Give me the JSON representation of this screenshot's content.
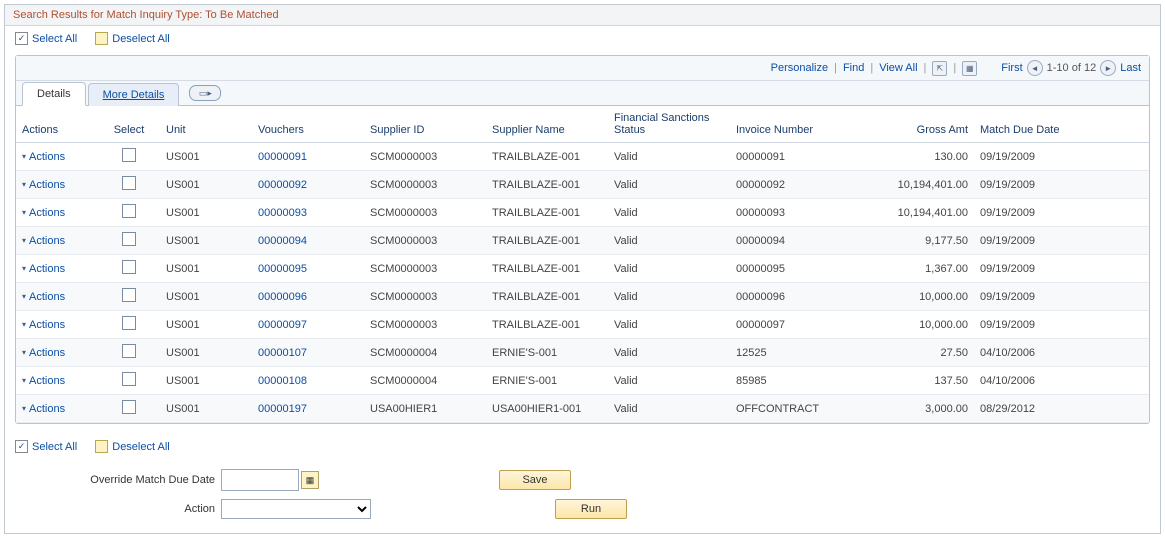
{
  "header": {
    "title": "Search Results for Match Inquiry Type: To Be Matched"
  },
  "selectBar": {
    "selectAll": "Select All",
    "deselectAll": "Deselect All"
  },
  "toolbar": {
    "personalize": "Personalize",
    "find": "Find",
    "viewAll": "View All"
  },
  "pager": {
    "first": "First",
    "range": "1-10 of 12",
    "last": "Last"
  },
  "tabs": {
    "details": "Details",
    "moreDetails": "More Details"
  },
  "columns": {
    "actions": "Actions",
    "select": "Select",
    "unit": "Unit",
    "vouchers": "Vouchers",
    "supplierId": "Supplier ID",
    "supplierName": "Supplier Name",
    "finSanctions": "Financial Sanctions Status",
    "invoiceNumber": "Invoice Number",
    "grossAmt": "Gross Amt",
    "matchDueDate": "Match Due Date"
  },
  "rowAction": "Actions",
  "rows": [
    {
      "unit": "US001",
      "voucher": "00000091",
      "supplierId": "SCM0000003",
      "supplierName": "TRAILBLAZE-001",
      "fin": "Valid",
      "invoice": "00000091",
      "amt": "130.00",
      "due": "09/19/2009"
    },
    {
      "unit": "US001",
      "voucher": "00000092",
      "supplierId": "SCM0000003",
      "supplierName": "TRAILBLAZE-001",
      "fin": "Valid",
      "invoice": "00000092",
      "amt": "10,194,401.00",
      "due": "09/19/2009"
    },
    {
      "unit": "US001",
      "voucher": "00000093",
      "supplierId": "SCM0000003",
      "supplierName": "TRAILBLAZE-001",
      "fin": "Valid",
      "invoice": "00000093",
      "amt": "10,194,401.00",
      "due": "09/19/2009"
    },
    {
      "unit": "US001",
      "voucher": "00000094",
      "supplierId": "SCM0000003",
      "supplierName": "TRAILBLAZE-001",
      "fin": "Valid",
      "invoice": "00000094",
      "amt": "9,177.50",
      "due": "09/19/2009"
    },
    {
      "unit": "US001",
      "voucher": "00000095",
      "supplierId": "SCM0000003",
      "supplierName": "TRAILBLAZE-001",
      "fin": "Valid",
      "invoice": "00000095",
      "amt": "1,367.00",
      "due": "09/19/2009"
    },
    {
      "unit": "US001",
      "voucher": "00000096",
      "supplierId": "SCM0000003",
      "supplierName": "TRAILBLAZE-001",
      "fin": "Valid",
      "invoice": "00000096",
      "amt": "10,000.00",
      "due": "09/19/2009"
    },
    {
      "unit": "US001",
      "voucher": "00000097",
      "supplierId": "SCM0000003",
      "supplierName": "TRAILBLAZE-001",
      "fin": "Valid",
      "invoice": "00000097",
      "amt": "10,000.00",
      "due": "09/19/2009"
    },
    {
      "unit": "US001",
      "voucher": "00000107",
      "supplierId": "SCM0000004",
      "supplierName": "ERNIE'S-001",
      "fin": "Valid",
      "invoice": "12525",
      "amt": "27.50",
      "due": "04/10/2006"
    },
    {
      "unit": "US001",
      "voucher": "00000108",
      "supplierId": "SCM0000004",
      "supplierName": "ERNIE'S-001",
      "fin": "Valid",
      "invoice": "85985",
      "amt": "137.50",
      "due": "04/10/2006"
    },
    {
      "unit": "US001",
      "voucher": "00000197",
      "supplierId": "USA00HIER1",
      "supplierName": "USA00HIER1-001",
      "fin": "Valid",
      "invoice": "OFFCONTRACT",
      "amt": "3,000.00",
      "due": "08/29/2012"
    }
  ],
  "form": {
    "overrideLabel": "Override Match Due Date",
    "actionLabel": "Action",
    "saveBtn": "Save",
    "runBtn": "Run",
    "overrideValue": "",
    "actionValue": ""
  }
}
